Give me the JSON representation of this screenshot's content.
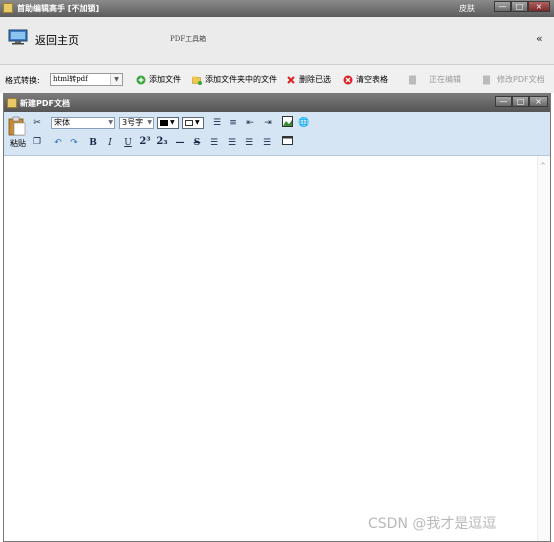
{
  "window": {
    "title": "首助编辑高手 [不加锁]",
    "skin_label": "皮肤",
    "minimize": "—",
    "maximize": "□",
    "close": "×"
  },
  "header": {
    "home_label": "返回主页",
    "pdf_tools_label": "PDF工具箱",
    "collapse": "«"
  },
  "toolbar": {
    "format_label": "格式转换:",
    "format_value": "html转pdf",
    "add_file": "添加文件",
    "add_folder": "添加文件夹中的文件",
    "delete_selected": "删除已选",
    "clear_table": "清空表格",
    "editing": "正在编辑",
    "modify_pdf": "修改PDF文档"
  },
  "inner_window": {
    "title": "新建PDF文档",
    "minimize": "—",
    "maximize": "□",
    "close": "×"
  },
  "editor_toolbar": {
    "paste_label": "粘贴",
    "font_value": "宋体",
    "size_value": "3号字",
    "bold": "B",
    "italic": "I",
    "underline": "U",
    "superscript": "2³",
    "subscript": "2₃",
    "hr": "—",
    "strike": "S",
    "font_color": "#000000",
    "bg_color": "#ffffff"
  },
  "watermark": "CSDN @我才是逗逗"
}
